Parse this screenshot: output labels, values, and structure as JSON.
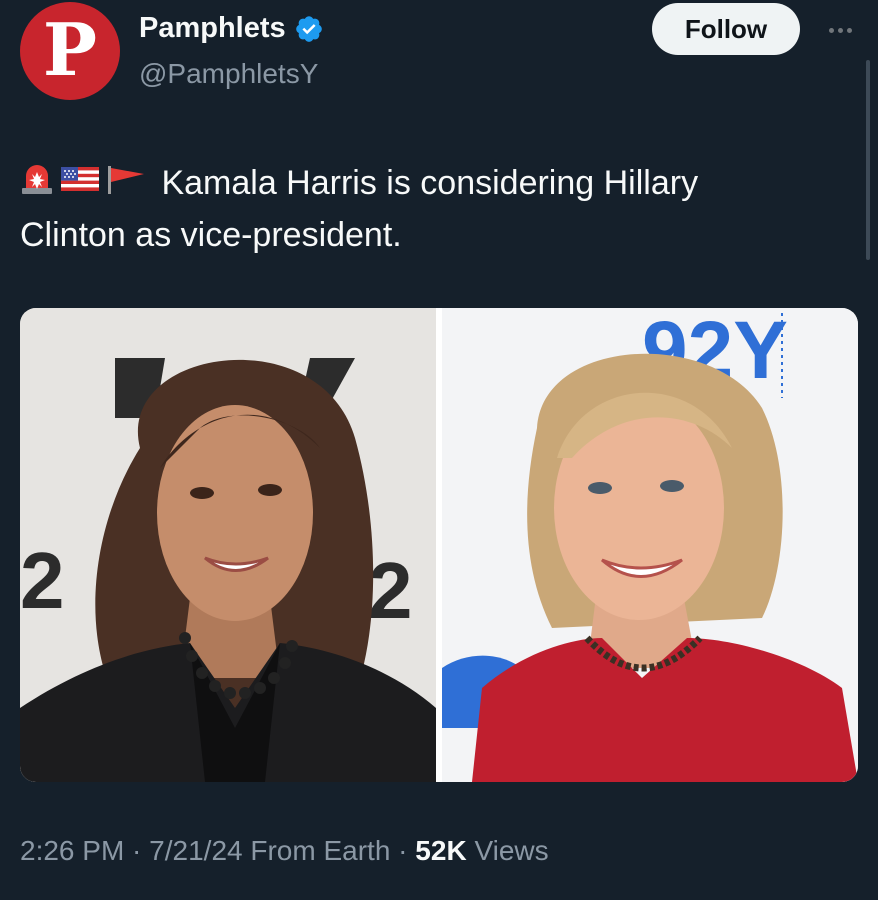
{
  "author": {
    "display_name": "Pamphlets",
    "handle": "@PamphletsY",
    "avatar_letter": "P",
    "avatar_color": "#c8252d",
    "verified": true
  },
  "actions": {
    "follow_label": "Follow",
    "more_icon": "more-horizontal-icon"
  },
  "tweet": {
    "emoji_icons": [
      "rotating-light-icon",
      "us-flag-icon",
      "red-flag-icon"
    ],
    "text_line1": "Kamala Harris is considering Hillary",
    "text_line2": "Clinton as vice-president."
  },
  "media": {
    "photos": [
      {
        "backdrop_text": "2Y  2"
      },
      {
        "backdrop_text": "92Y"
      }
    ]
  },
  "meta": {
    "time": "2:26 PM",
    "sep1": " · ",
    "date": "7/21/24",
    "source": " From Earth",
    "sep2": " · ",
    "views_count": "52K",
    "views_label": " Views"
  },
  "colors": {
    "background": "#15202b",
    "text": "#f7f9f9",
    "muted": "#8b98a5",
    "verified": "#1d9bf0"
  }
}
